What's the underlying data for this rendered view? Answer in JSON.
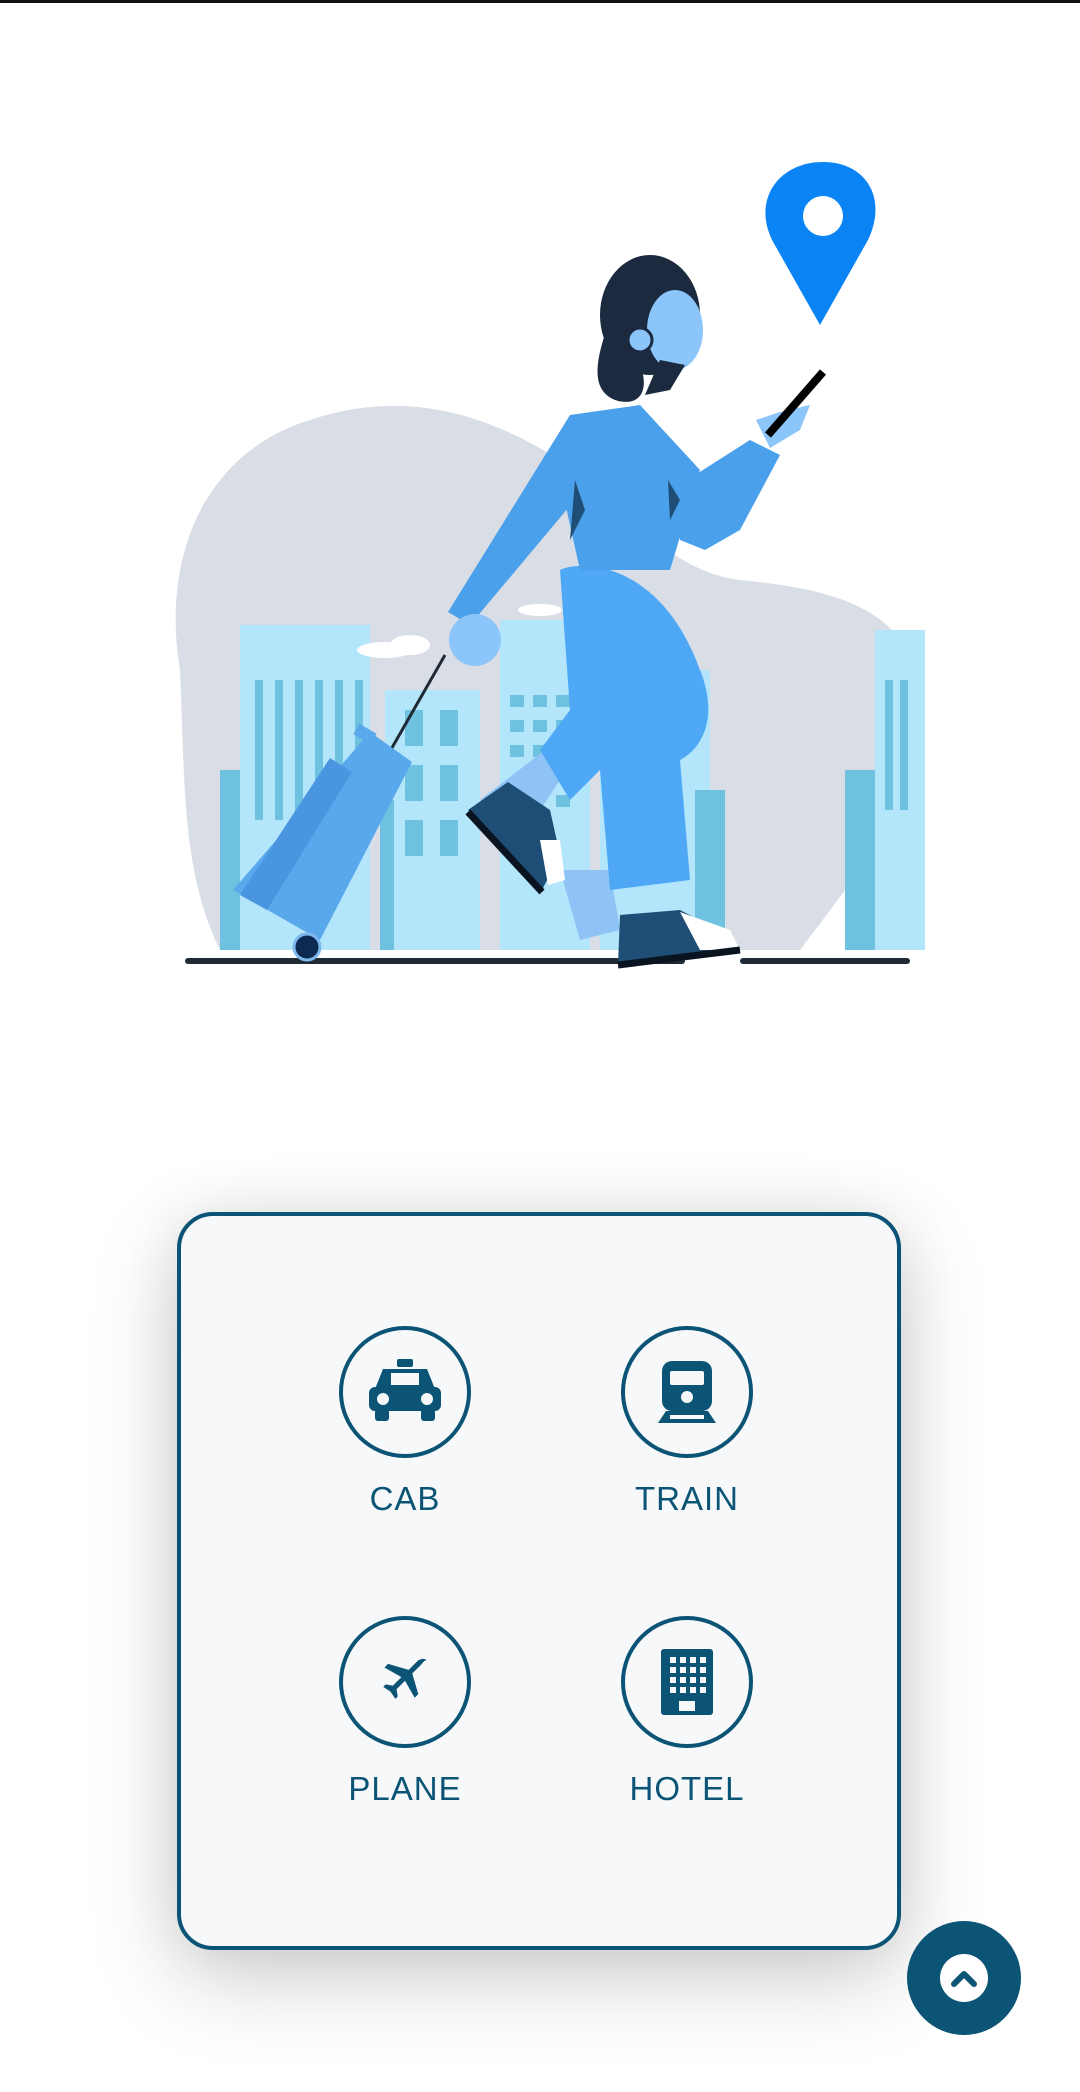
{
  "screen": {
    "accent_color": "#0b5475",
    "card_background": "#f7f8f9"
  },
  "illustration": {
    "description_icon": "traveler-with-suitcase-illustration",
    "pin_icon": "location-pin-icon"
  },
  "options": [
    {
      "label": "CAB",
      "icon": "taxi-icon"
    },
    {
      "label": "TRAIN",
      "icon": "train-icon"
    },
    {
      "label": "PLANE",
      "icon": "plane-icon"
    },
    {
      "label": "HOTEL",
      "icon": "hotel-icon"
    }
  ],
  "fab": {
    "icon": "chevron-up-icon"
  }
}
